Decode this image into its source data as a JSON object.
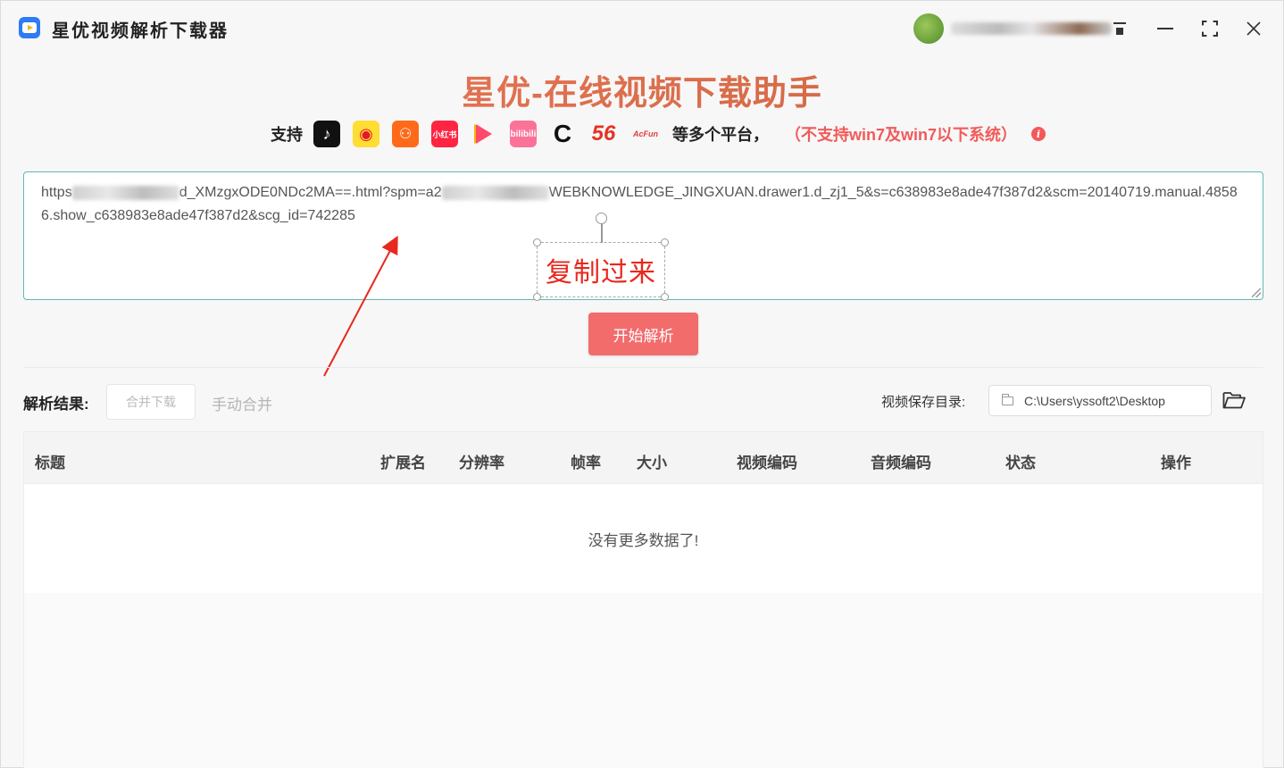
{
  "app": {
    "title": "星优视频解析下载器",
    "hero_title": "星优-在线视频下载助手"
  },
  "platforms": {
    "support_label": "支持",
    "icons": [
      {
        "name": "douyin-icon",
        "glyph": "♪"
      },
      {
        "name": "weibo-icon",
        "glyph": "◉"
      },
      {
        "name": "kuaishou-icon",
        "glyph": "⚇"
      },
      {
        "name": "xiaohongshu-icon",
        "glyph": "小红书"
      },
      {
        "name": "video-play-icon",
        "glyph": ""
      },
      {
        "name": "bilibili-icon",
        "glyph": "bilibili"
      },
      {
        "name": "cctv-icon",
        "glyph": "C"
      },
      {
        "name": "56-icon",
        "glyph": "56"
      },
      {
        "name": "acfun-icon",
        "glyph": "AcFun"
      }
    ],
    "suffix": "等多个平台，",
    "warning": "（不支持win7及win7以下系统）",
    "info_glyph": "i"
  },
  "url_input": {
    "value_part1": "https",
    "value_part2": "d_XMzgxODE0NDc2MA==.html?spm=a2",
    "value_part3": "WEBKNOWLEDGE_JINGXUAN.drawer1.d_zj1_5&s=c638983e8ade47f387d2&scm=20140719.manual.48586.show_c638983e8ade47f387d2&scg_id=742285"
  },
  "annotation": {
    "text": "复制过来",
    "color": "#e8281e"
  },
  "actions": {
    "start_parse": "开始解析"
  },
  "results": {
    "label": "解析结果:",
    "merge_download": "合并下载",
    "manual_merge": "手动合并",
    "save_dir_label": "视频保存目录:",
    "save_dir_value": "C:\\Users\\yssoft2\\Desktop"
  },
  "table": {
    "columns": [
      "标题",
      "扩展名",
      "分辨率",
      "帧率",
      "大小",
      "视频编码",
      "音频编码",
      "状态",
      "操作"
    ],
    "empty_text": "没有更多数据了!"
  },
  "colors": {
    "accent": "#f26c6c",
    "warning": "#f25a5a",
    "input_border": "#5fb8b4"
  }
}
